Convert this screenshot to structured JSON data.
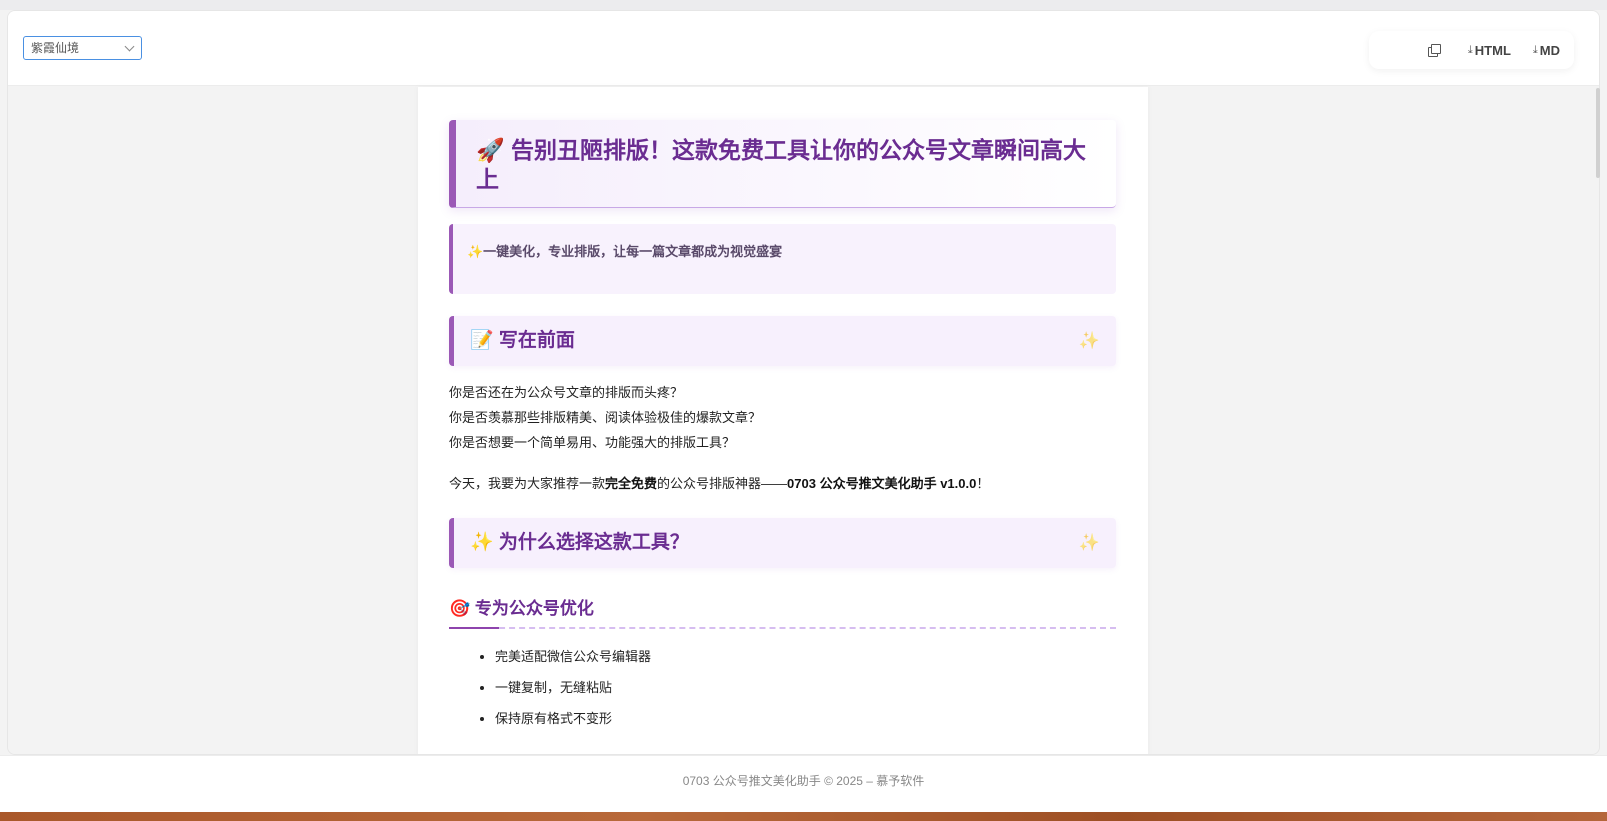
{
  "header": {
    "theme_select": {
      "value": "紫霞仙境"
    },
    "actions": {
      "copy_label": "",
      "html_label": "HTML",
      "md_label": "MD"
    }
  },
  "article": {
    "title": "🚀 告别丑陋排版！这款免费工具让你的公众号文章瞬间高大上",
    "lead": "✨一键美化，专业排版，让每一篇文章都成为视觉盛宴",
    "section1": {
      "title": "📝 写在前面",
      "sparkle": "✨"
    },
    "intro_lines": [
      "你是否还在为公众号文章的排版而头疼？",
      "你是否羡慕那些排版精美、阅读体验极佳的爆款文章？",
      "你是否想要一个简单易用、功能强大的排版工具？"
    ],
    "recommend": {
      "prefix": "今天，我要为大家推荐一款",
      "bold1": "完全免费",
      "middle": "的公众号排版神器——",
      "bold2": "0703 公众号推文美化助手 v1.0.0",
      "suffix": "！"
    },
    "section2": {
      "title": "✨ 为什么选择这款工具？",
      "sparkle": "✨"
    },
    "subsection1": {
      "title": "🎯 专为公众号优化"
    },
    "features": [
      "完美适配微信公众号编辑器",
      "一键复制，无缝粘贴",
      "保持原有格式不变形"
    ]
  },
  "footer": {
    "text": "0703 公众号推文美化助手 © 2025 – 慕予软件"
  }
}
